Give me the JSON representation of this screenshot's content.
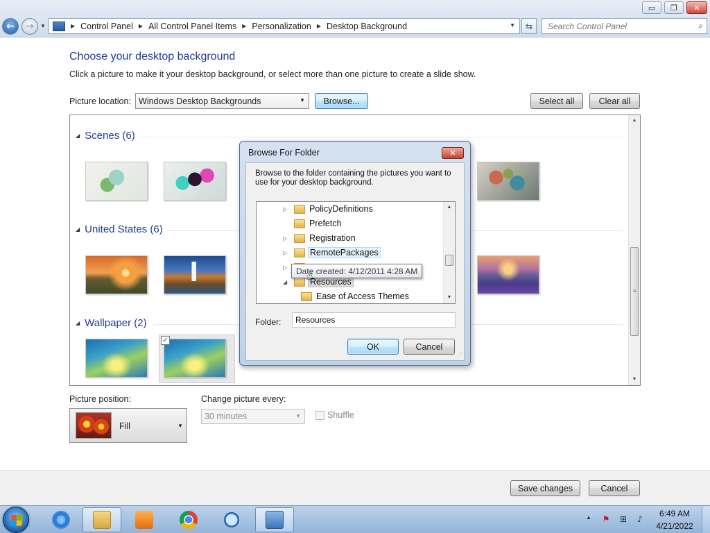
{
  "window": {
    "minimize": "▭",
    "restore": "❐",
    "close": "✕"
  },
  "address": {
    "crumbs": [
      "Control Panel",
      "All Control Panel Items",
      "Personalization",
      "Desktop Background"
    ],
    "search_placeholder": "Search Control Panel"
  },
  "main": {
    "title": "Choose your desktop background",
    "subtitle": "Click a picture to make it your desktop background, or select more than one picture to create a slide show.",
    "location_label": "Picture location:",
    "location_value": "Windows Desktop Backgrounds",
    "browse_label": "Browse...",
    "select_all_label": "Select all",
    "clear_all_label": "Clear all",
    "groups": [
      {
        "label": "Scenes (6)"
      },
      {
        "label": "United States (6)"
      },
      {
        "label": "Wallpaper (2)"
      }
    ],
    "wallpaper_checked": "✓",
    "position_label": "Picture position:",
    "position_value": "Fill",
    "change_label": "Change picture every:",
    "change_value": "30 minutes",
    "shuffle_label": "Shuffle"
  },
  "footer": {
    "save_label": "Save changes",
    "cancel_label": "Cancel"
  },
  "dialog": {
    "title": "Browse For Folder",
    "close_glyph": "✕",
    "description": "Browse to the folder containing the pictures you want to use for your desktop background.",
    "tree": [
      {
        "label": "PolicyDefinitions"
      },
      {
        "label": "Prefetch"
      },
      {
        "label": "Registration"
      },
      {
        "label": "RemotePackages"
      },
      {
        "label": "Resources"
      },
      {
        "label": "Ease of Access Themes"
      }
    ],
    "tooltip": "Date created: 4/12/2011 4:28 AM",
    "folder_label": "Folder:",
    "folder_value": "Resources",
    "ok_label": "OK",
    "cancel_label": "Cancel"
  },
  "taskbar": {
    "apps": [
      "internet-explorer",
      "windows-explorer",
      "media-player",
      "chrome",
      "magnifier",
      "control-panel"
    ],
    "time": "6:49 AM",
    "date": "4/21/2022"
  },
  "colors": {
    "accent_heading": "#1e3f8a",
    "taskbar": "#a9c2e0"
  }
}
